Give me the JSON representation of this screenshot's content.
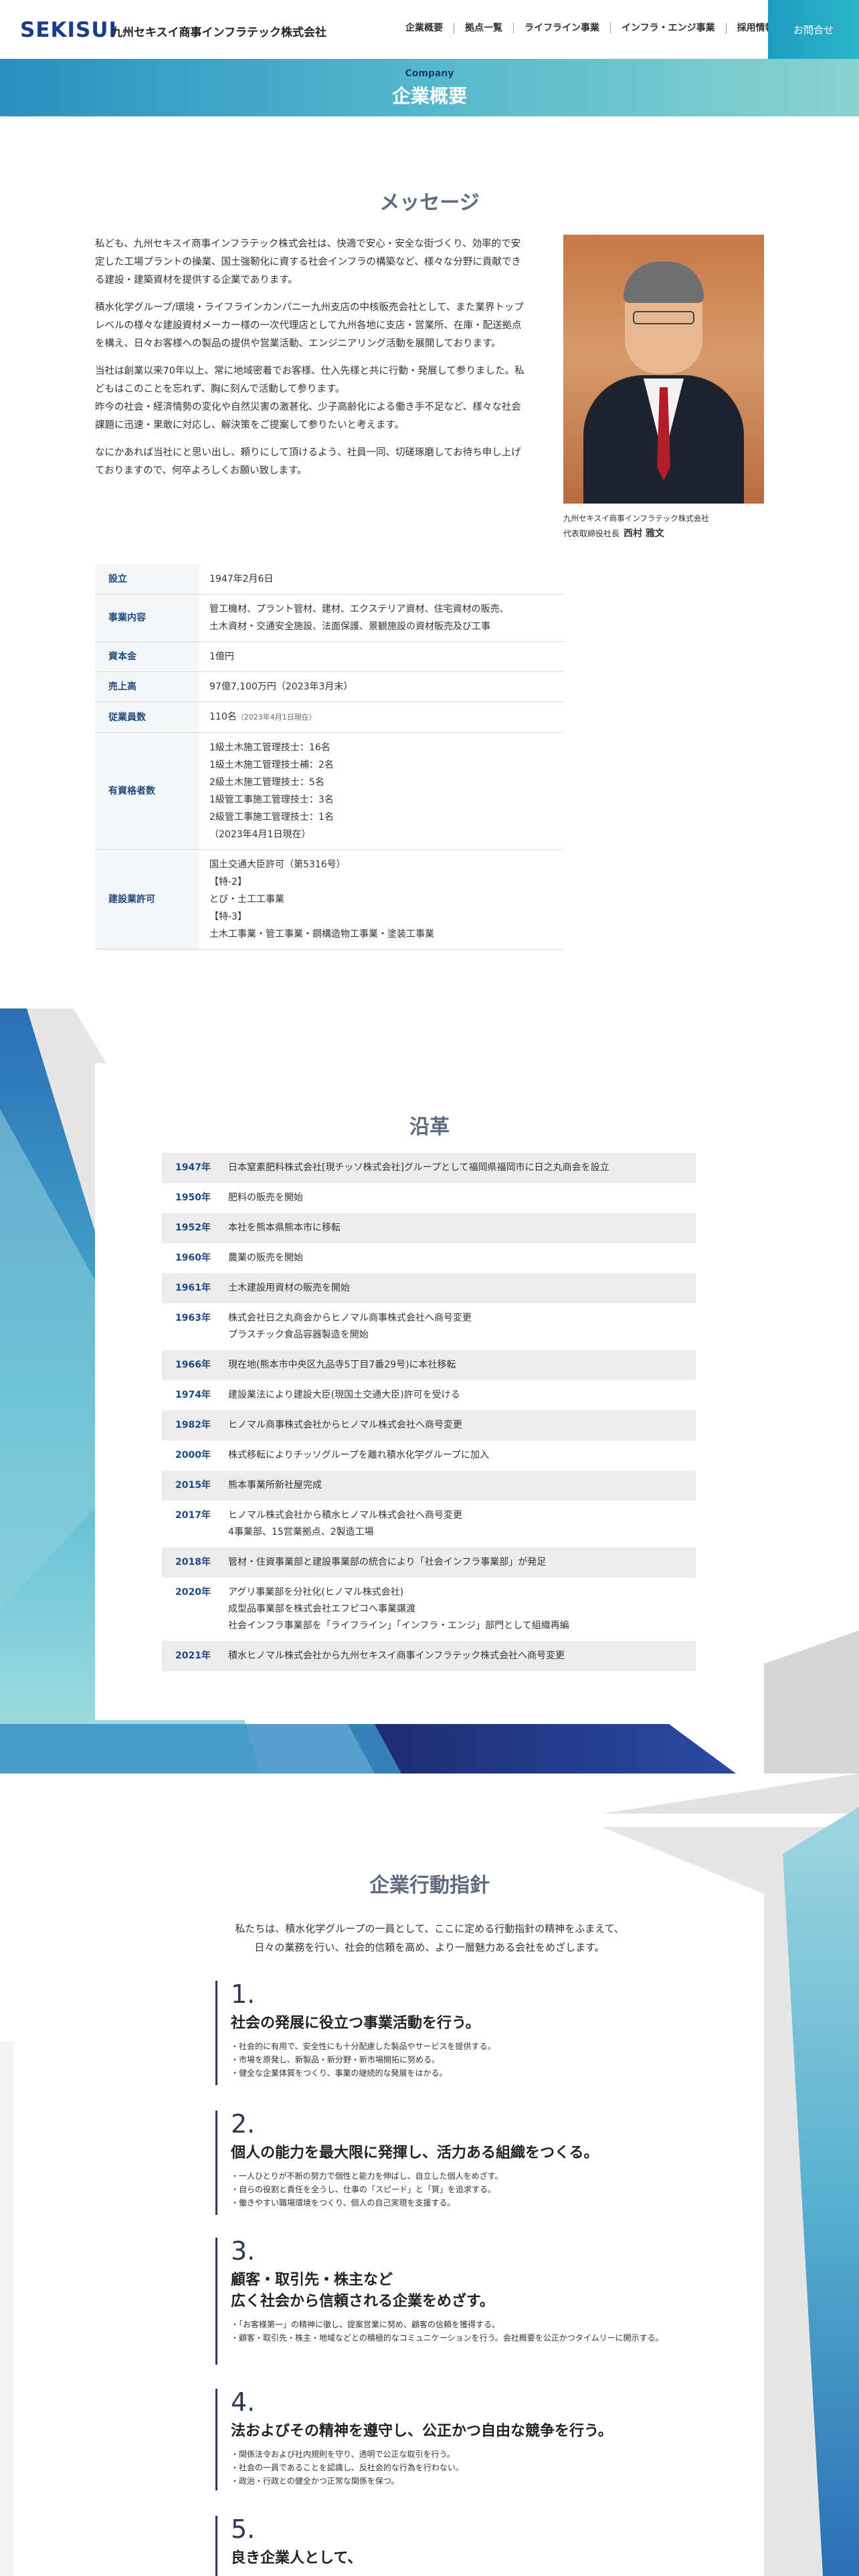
{
  "header": {
    "logo": "SEKISUI",
    "company_name": "九州セキスイ商事インフラテック株式会社",
    "nav": [
      "企業概要",
      "拠点一覧",
      "ライフライン事業",
      "インフラ・エンジ事業",
      "採用情報"
    ],
    "contact": "お問合せ"
  },
  "band": {
    "en": "Company",
    "jp": "企業概要"
  },
  "message": {
    "heading": "メッセージ",
    "paragraphs": [
      "私ども、九州セキスイ商事インフラテック株式会社は、快適で安心・安全な街づくり、効率的で安定した工場プラントの操業、国土強靭化に資する社会インフラの構築など、様々な分野に貢献できる建設・建築資材を提供する企業であります。",
      "積水化学グループ/環境・ライフラインカンパニー九州支店の中核販売会社として、また業界トップレベルの様々な建設資材メーカー様の一次代理店として九州各地に支店・営業所、在庫・配送拠点を構え、日々お客様への製品の提供や営業活動、エンジニアリング活動を展開しております。",
      "当社は創業以来70年以上、常に地域密着でお客様、仕入先様と共に行動・発展して参りました。私どもはこのことを忘れず、胸に刻んで活動して参ります。",
      "昨今の社会・経済情勢の変化や自然災害の激甚化、少子高齢化による働き手不足など、様々な社会課題に迅速・果敢に対応し、解決策をご提案して参りたいと考えます。",
      "なにかあれば当社にと思い出し、頼りにして頂けるよう、社員一同、切磋琢磨してお待ち申し上げておりますので、何卒よろしくお願い致します。"
    ],
    "caption_company": "九州セキスイ商事インフラテック株式会社",
    "caption_role": "代表取締役社長",
    "caption_name": "西村 雅文"
  },
  "info": [
    {
      "k": "設立",
      "v": [
        "1947年2月6日"
      ]
    },
    {
      "k": "事業内容",
      "v": [
        "管工機材、プラント管材、建材、エクステリア資材、住宅資材の販売、",
        "土木資材・交通安全施設、法面保護、景観施設の資材販売及び工事"
      ]
    },
    {
      "k": "資本金",
      "v": [
        "1億円"
      ]
    },
    {
      "k": "売上高",
      "v": [
        "97億7,100万円（2023年3月末）"
      ]
    },
    {
      "k": "従業員数",
      "v": [
        "110名"
      ],
      "note": "（2023年4月1日現在）"
    },
    {
      "k": "有資格者数",
      "v": [
        "1級土木施工管理技士：16名",
        "1級土木施工管理技士補：2名",
        "2級土木施工管理技士：5名",
        "1級管工事施工管理技士：3名",
        "2級管工事施工管理技士：1名",
        "（2023年4月1日現在）"
      ]
    },
    {
      "k": "建設業許可",
      "v": [
        "国土交通大臣許可（第5316号）",
        "【特-2】",
        "とび・土工工事業",
        "【特-3】",
        "土木工事業・管工事業・鋼構造物工事業・塗装工事業"
      ]
    }
  ],
  "history": {
    "heading": "沿革",
    "rows": [
      {
        "y": "1947年",
        "e": [
          "日本窒素肥料株式会社[現チッソ株式会社]グループとして福岡県福岡市に日之丸商会を設立"
        ]
      },
      {
        "y": "1950年",
        "e": [
          "肥料の販売を開始"
        ]
      },
      {
        "y": "1952年",
        "e": [
          "本社を熊本県熊本市に移転"
        ]
      },
      {
        "y": "1960年",
        "e": [
          "農業の販売を開始"
        ]
      },
      {
        "y": "1961年",
        "e": [
          "土木建設用資材の販売を開始"
        ]
      },
      {
        "y": "1963年",
        "e": [
          "株式会社日之丸商会からヒノマル商事株式会社へ商号変更",
          "プラスチック食品容器製造を開始"
        ]
      },
      {
        "y": "1966年",
        "e": [
          "現在地(熊本市中央区九品寺5丁目7番29号)に本社移転"
        ]
      },
      {
        "y": "1974年",
        "e": [
          "建設業法により建設大臣(現国土交通大臣)許可を受ける"
        ]
      },
      {
        "y": "1982年",
        "e": [
          "ヒノマル商事株式会社からヒノマル株式会社へ商号変更"
        ]
      },
      {
        "y": "2000年",
        "e": [
          "株式移転によりチッソグループを離れ積水化学グループに加入"
        ]
      },
      {
        "y": "2015年",
        "e": [
          "熊本事業所新社屋完成"
        ]
      },
      {
        "y": "2017年",
        "e": [
          "ヒノマル株式会社から積水ヒノマル株式会社へ商号変更",
          "4事業部、15営業拠点、2製造工場"
        ]
      },
      {
        "y": "2018年",
        "e": [
          "管材・住資事業部と建設事業部の統合により「社会インフラ事業部」が発足"
        ]
      },
      {
        "y": "2020年",
        "e": [
          "アグリ事業部を分社化(ヒノマル株式会社)",
          "成型品事業部を株式会社エフピコへ事業譲渡",
          "社会インフラ事業部を「ライフライン」「インフラ・エンジ」部門として組織再編"
        ]
      },
      {
        "y": "2021年",
        "e": [
          "積水ヒノマル株式会社から九州セキスイ商事インフラテック株式会社へ商号変更"
        ]
      }
    ]
  },
  "conduct": {
    "heading": "企業行動指針",
    "intro": [
      "私たちは、積水化学グループの一員として、ここに定める行動指針の精神をふまえて、",
      "日々の業務を行い、社会的信頼を高め、より一層魅力ある会社をめざします。"
    ],
    "items": [
      {
        "num": "1.",
        "title": [
          "社会の発展に役立つ事業活動を行う。"
        ],
        "points": [
          "・社会的に有用で、安全性にも十分配慮した製品やサービスを提供する。",
          "・市場を原発し、新製品・新分野・新市場開拓に努める。",
          "・健全な企業体質をつくり、事業の継続的な発展をはかる。"
        ]
      },
      {
        "num": "2.",
        "title": [
          "個人の能力を最大限に発揮し、活力ある組織をつくる。"
        ],
        "points": [
          "・一人ひとりが不断の努力で個性と能力を伸ばし、自立した個人をめざす。",
          "・自らの役割と責任を全うし、仕事の「スピード」と「質」を追求する。",
          "・働きやすい職場環境をつくり、個人の自己実現を支援する。"
        ]
      },
      {
        "num": "3.",
        "title": [
          "顧客・取引先・株主など",
          "広く社会から信頼される企業をめざす。"
        ],
        "points": [
          "・「お客様第一」の精神に徹し、提案営業に努め、顧客の信頼を獲得する。",
          "・顧客・取引先・株主・地域などとの積極的なコミュニケーションを行う。会社概要を公正かつタイムリーに開示する。"
        ]
      },
      {
        "num": "4.",
        "title": [
          "法およびその精神を遵守し、公正かつ自由な競争を行う。"
        ],
        "points": [
          "・関係法令および社内規則を守り、透明で公正な取引を行う。",
          "・社会の一員であることを認識し、反社会的な行為を行わない。",
          "・政治・行政との健全かつ正常な関係を保つ。"
        ]
      },
      {
        "num": "5.",
        "title": [
          "良き企業人として、"
        ],
        "points": []
      }
    ]
  }
}
